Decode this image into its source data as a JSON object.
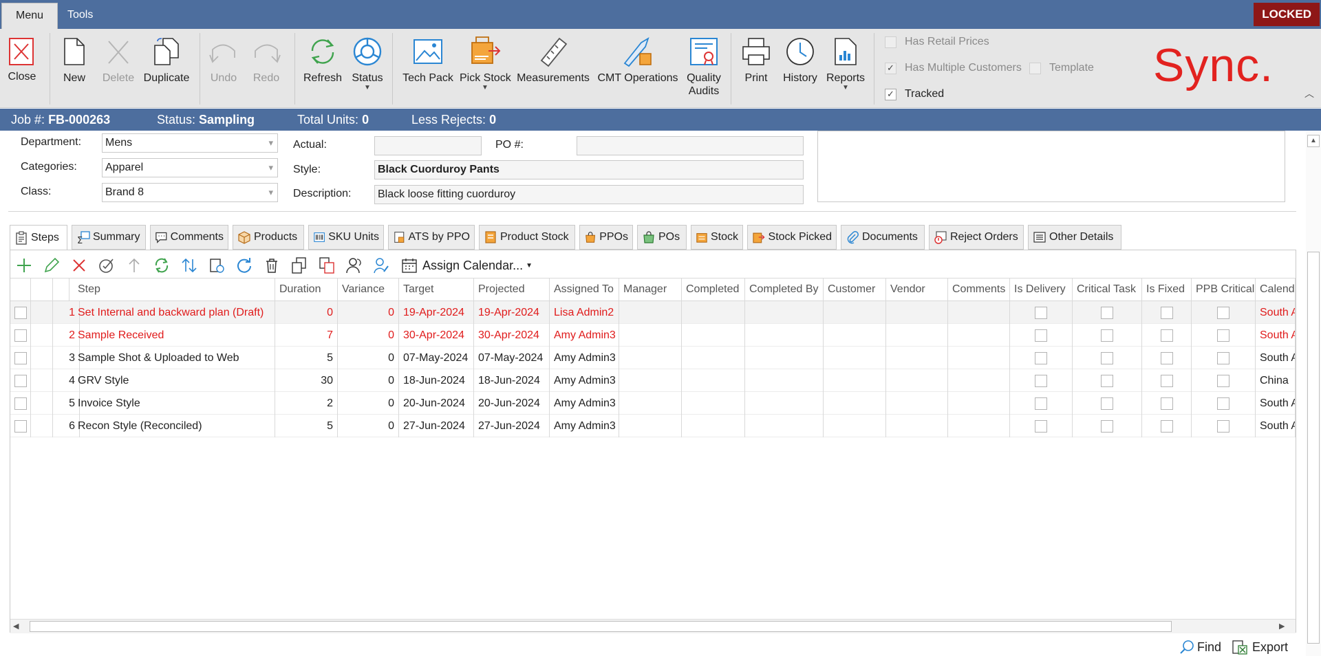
{
  "menu": {
    "tabs": [
      "Menu",
      "Tools"
    ],
    "locked": "LOCKED"
  },
  "ribbon": {
    "buttons": {
      "close": "Close",
      "new": "New",
      "delete": "Delete",
      "duplicate": "Duplicate",
      "undo": "Undo",
      "redo": "Redo",
      "refresh": "Refresh",
      "status": "Status",
      "tech_pack": "Tech Pack",
      "pick_stock": "Pick Stock",
      "measurements": "Measurements",
      "cmt_operations": "CMT Operations",
      "quality_audits_1": "Quality",
      "quality_audits_2": "Audits",
      "print": "Print",
      "history": "History",
      "reports": "Reports"
    },
    "options": {
      "has_retail_prices": "Has Retail Prices",
      "has_multiple_customers": "Has Multiple Customers",
      "template": "Template",
      "tracked": "Tracked"
    },
    "logo": "Sync."
  },
  "statusbar": {
    "job_label": "Job #:",
    "job_value": "FB-000263",
    "status_label": "Status:",
    "status_value": "Sampling",
    "total_label": "Total Units:",
    "total_value": "0",
    "rejects_label": "Less Rejects:",
    "rejects_value": "0"
  },
  "form": {
    "department_label": "Department:",
    "department_value": "Mens",
    "categories_label": "Categories:",
    "categories_value": "Apparel",
    "class_label": "Class:",
    "class_value": "Brand 8",
    "actual_label": "Actual:",
    "actual_value": "",
    "po_label": "PO #:",
    "po_value": "",
    "style_label": "Style:",
    "style_value": "Black Cuorduroy Pants",
    "description_label": "Description:",
    "description_value": "Black loose fitting cuorduroy"
  },
  "tabs": [
    "Steps",
    "Summary",
    "Comments",
    "Products",
    "SKU Units",
    "ATS by PPO",
    "Product Stock",
    "PPOs",
    "POs",
    "Stock",
    "Stock Picked",
    "Documents",
    "Reject Orders",
    "Other Details"
  ],
  "grid_toolbar": {
    "assign_calendar": "Assign Calendar..."
  },
  "grid": {
    "columns": [
      "Step",
      "Duration",
      "Variance",
      "Target",
      "Projected",
      "Assigned To",
      "Manager",
      "Completed",
      "Completed By",
      "Customer",
      "Vendor",
      "Comments",
      "Is Delivery",
      "Critical Task",
      "Is Fixed",
      "PPB Critical",
      "Calend"
    ],
    "rows": [
      {
        "n": "1",
        "step": "Set Internal and backward plan (Draft)",
        "duration": "0",
        "variance": "0",
        "target": "19-Apr-2024",
        "projected": "19-Apr-2024",
        "assigned": "Lisa Admin2",
        "calendar": "South A",
        "red": true
      },
      {
        "n": "2",
        "step": "Sample Received",
        "duration": "7",
        "variance": "0",
        "target": "30-Apr-2024",
        "projected": "30-Apr-2024",
        "assigned": "Amy Admin3",
        "calendar": "South A",
        "red": true
      },
      {
        "n": "3",
        "step": "Sample Shot & Uploaded to Web",
        "duration": "5",
        "variance": "0",
        "target": "07-May-2024",
        "projected": "07-May-2024",
        "assigned": "Amy Admin3",
        "calendar": "South A",
        "red": false
      },
      {
        "n": "4",
        "step": "GRV Style",
        "duration": "30",
        "variance": "0",
        "target": "18-Jun-2024",
        "projected": "18-Jun-2024",
        "assigned": "Amy Admin3",
        "calendar": "China",
        "red": false
      },
      {
        "n": "5",
        "step": "Invoice Style",
        "duration": "2",
        "variance": "0",
        "target": "20-Jun-2024",
        "projected": "20-Jun-2024",
        "assigned": "Amy Admin3",
        "calendar": "South A",
        "red": false
      },
      {
        "n": "6",
        "step": "Recon Style (Reconciled)",
        "duration": "5",
        "variance": "0",
        "target": "27-Jun-2024",
        "projected": "27-Jun-2024",
        "assigned": "Amy Admin3",
        "calendar": "South A",
        "red": false
      }
    ]
  },
  "footer": {
    "find": "Find",
    "export": "Export"
  },
  "colors": {
    "header_blue": "#4d6e9e",
    "locked_red": "#8e1717",
    "logo_red": "#e2221f",
    "overdue_red": "#e01b1b"
  }
}
